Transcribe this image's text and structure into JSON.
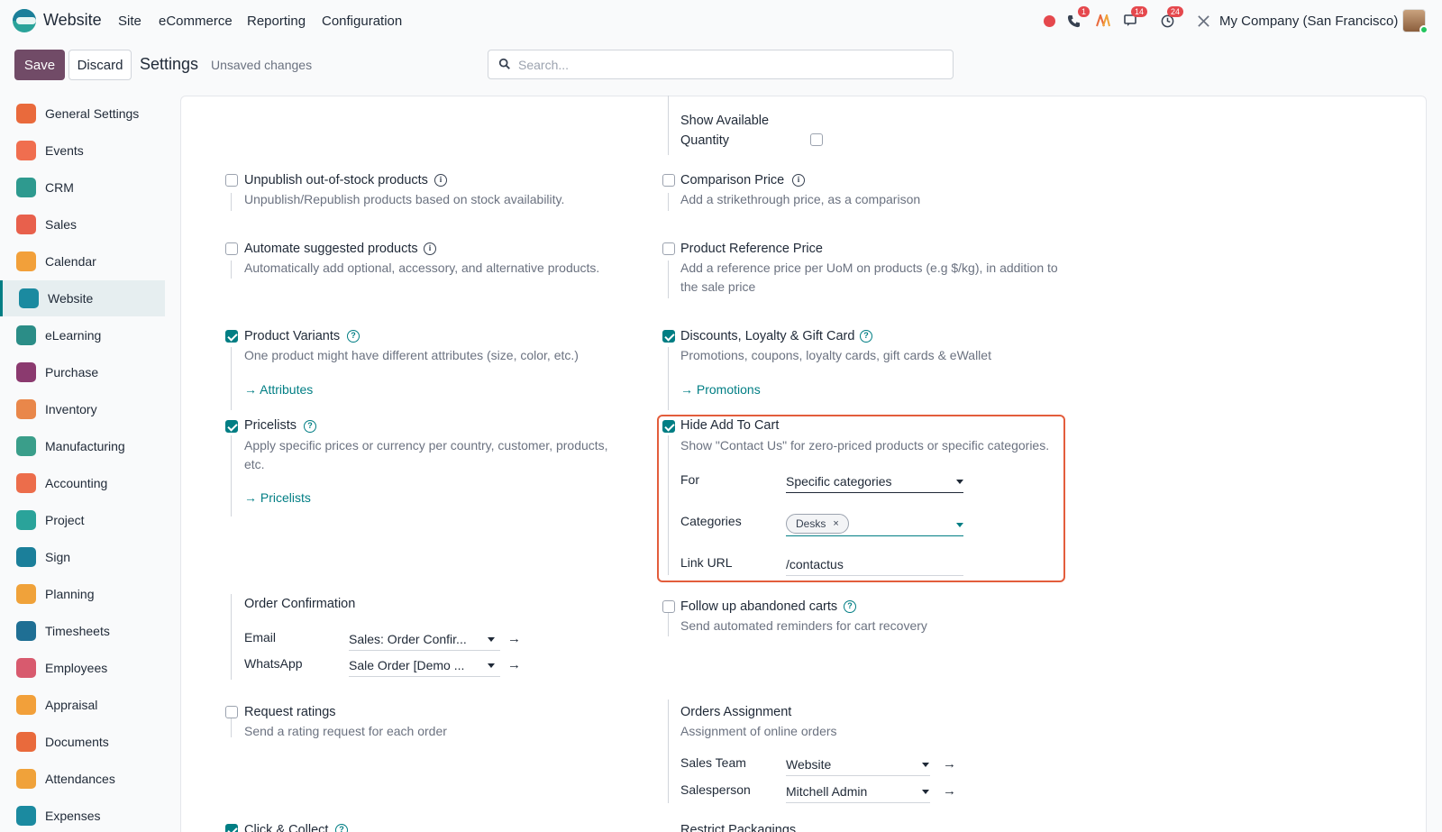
{
  "topbar": {
    "app_name": "Website",
    "menus": [
      "Site",
      "eCommerce",
      "Reporting",
      "Configuration"
    ],
    "badges": {
      "phone": "1",
      "chat": "14",
      "activity": "24"
    },
    "company": "My Company (San Francisco)"
  },
  "control": {
    "save": "Save",
    "discard": "Discard",
    "title": "Settings",
    "status": "Unsaved changes",
    "search_placeholder": "Search..."
  },
  "sidebar": {
    "items": [
      {
        "label": "General Settings",
        "icon": "general-settings-icon",
        "color": "#e96a3c"
      },
      {
        "label": "Events",
        "icon": "events-icon",
        "color": "#f06e4f"
      },
      {
        "label": "CRM",
        "icon": "crm-icon",
        "color": "#2e9a8f"
      },
      {
        "label": "Sales",
        "icon": "sales-icon",
        "color": "#e8604c"
      },
      {
        "label": "Calendar",
        "icon": "calendar-icon",
        "color": "#f2a03a"
      },
      {
        "label": "Website",
        "icon": "website-icon",
        "color": "#1b8aa0"
      },
      {
        "label": "eLearning",
        "icon": "elearning-icon",
        "color": "#2b8d87"
      },
      {
        "label": "Purchase",
        "icon": "purchase-icon",
        "color": "#8b3a6f"
      },
      {
        "label": "Inventory",
        "icon": "inventory-icon",
        "color": "#e9874a"
      },
      {
        "label": "Manufacturing",
        "icon": "manufacturing-icon",
        "color": "#3a9e8a"
      },
      {
        "label": "Accounting",
        "icon": "accounting-icon",
        "color": "#ec6d4b"
      },
      {
        "label": "Project",
        "icon": "project-icon",
        "color": "#2aa39a"
      },
      {
        "label": "Sign",
        "icon": "sign-icon",
        "color": "#1b7f9a"
      },
      {
        "label": "Planning",
        "icon": "planning-icon",
        "color": "#f0a23a"
      },
      {
        "label": "Timesheets",
        "icon": "timesheets-icon",
        "color": "#1f6f94"
      },
      {
        "label": "Employees",
        "icon": "employees-icon",
        "color": "#d85a6e"
      },
      {
        "label": "Appraisal",
        "icon": "appraisal-icon",
        "color": "#f2a03a"
      },
      {
        "label": "Documents",
        "icon": "documents-icon",
        "color": "#e96a3c"
      },
      {
        "label": "Attendances",
        "icon": "attendances-icon",
        "color": "#f0a23a"
      },
      {
        "label": "Expenses",
        "icon": "expenses-icon",
        "color": "#1b8aa0"
      }
    ],
    "active_index": 5
  },
  "settings": {
    "show_available_qty": {
      "title_line1": "Show Available",
      "title_line2": "Quantity"
    },
    "unpublish_oos": {
      "title": "Unpublish out-of-stock products",
      "desc": "Unpublish/Republish products based on stock availability."
    },
    "comparison_price": {
      "title": "Comparison Price",
      "desc": "Add a strikethrough price, as a comparison"
    },
    "automate_suggested": {
      "title": "Automate suggested products",
      "desc": "Automatically add optional, accessory, and alternative products."
    },
    "product_ref_price": {
      "title": "Product Reference Price",
      "desc_line1": "Add a reference price per UoM on products (e.g $/kg), in addition to",
      "desc_line2": "the sale price"
    },
    "product_variants": {
      "title": "Product Variants",
      "desc": "One product might have different attributes (size, color, etc.)",
      "link": "Attributes"
    },
    "discounts": {
      "title": "Discounts, Loyalty & Gift Card",
      "desc": "Promotions, coupons, loyalty cards, gift cards & eWallet",
      "link": "Promotions"
    },
    "pricelists": {
      "title": "Pricelists",
      "desc_line1": "Apply specific prices or currency per country, customer, products,",
      "desc_line2": "etc.",
      "link": "Pricelists"
    },
    "hide_add_to_cart": {
      "title": "Hide Add To Cart",
      "desc": "Show \"Contact Us\" for zero-priced products or specific categories.",
      "for_label": "For",
      "for_value": "Specific categories",
      "categories_label": "Categories",
      "category_tag": "Desks",
      "link_url_label": "Link URL",
      "link_url_value": "/contactus"
    },
    "order_confirmation": {
      "title": "Order Confirmation",
      "email_label": "Email",
      "email_value": "Sales: Order Confir...",
      "whatsapp_label": "WhatsApp",
      "whatsapp_value": "Sale Order [Demo ..."
    },
    "follow_up_carts": {
      "title": "Follow up abandoned carts",
      "desc": "Send automated reminders for cart recovery"
    },
    "request_ratings": {
      "title": "Request ratings",
      "desc": "Send a rating request for each order"
    },
    "orders_assignment": {
      "title": "Orders Assignment",
      "desc": "Assignment of online orders",
      "team_label": "Sales Team",
      "team_value": "Website",
      "person_label": "Salesperson",
      "person_value": "Mitchell Admin"
    },
    "click_collect": {
      "title": "Click & Collect"
    },
    "restrict_packagings": {
      "title": "Restrict Packagings"
    }
  },
  "colors": {
    "brand": "#714b67",
    "accent": "#017e84",
    "highlight": "#e35d3c"
  }
}
